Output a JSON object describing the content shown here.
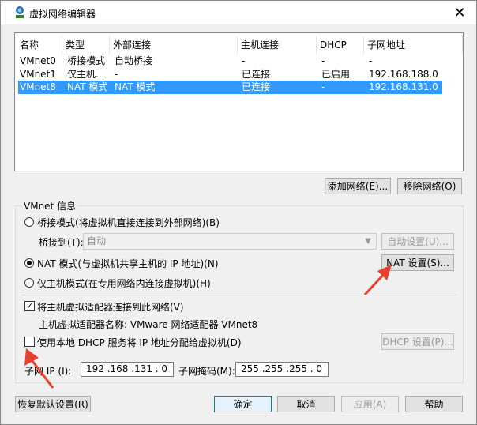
{
  "window": {
    "title": "虚拟网络编辑器",
    "icon": "vmware-network-icon",
    "close": "✕"
  },
  "table": {
    "columns": [
      "名称",
      "类型",
      "外部连接",
      "主机连接",
      "DHCP",
      "子网地址"
    ],
    "rows": [
      {
        "name": "VMnet0",
        "type": "桥接模式",
        "external": "自动桥接",
        "host": "-",
        "dhcp": "-",
        "subnet": "-"
      },
      {
        "name": "VMnet1",
        "type": "仅主机...",
        "external": "-",
        "host": "已连接",
        "dhcp": "已启用",
        "subnet": "192.168.188.0"
      },
      {
        "name": "VMnet8",
        "type": "NAT 模式",
        "external": "NAT 模式",
        "host": "已连接",
        "dhcp": "-",
        "subnet": "192.168.131.0"
      }
    ],
    "selected_row": "VMnet8"
  },
  "table_buttons": {
    "add": "添加网络(E)...",
    "remove": "移除网络(O)"
  },
  "vmnet_info": {
    "title": "VMnet 信息",
    "bridge_option": "桥接模式(将虚拟机直接连接到外部网络)(B)",
    "bridge_to_label": "桥接到(T):",
    "bridge_to_value": "自动",
    "auto_settings": "自动设置(U)...",
    "nat_option": "NAT 模式(与虚拟机共享主机的 IP 地址)(N)",
    "nat_settings": "NAT 设置(S)...",
    "host_only_option": "仅主机模式(在专用网络内连接虚拟机)(H)",
    "selected_mode": "nat",
    "connect_adapter": "将主机虚拟适配器连接到此网络(V)",
    "connect_adapter_checked": true,
    "adapter_name": "主机虚拟适配器名称: VMware 网络适配器 VMnet8",
    "use_dhcp": "使用本地 DHCP 服务将 IP 地址分配给虚拟机(D)",
    "use_dhcp_checked": false,
    "dhcp_settings": "DHCP 设置(P)...",
    "subnet_ip_label": "子网 IP (I):",
    "subnet_ip": "192 .168 .131 . 0",
    "subnet_mask_label": "子网掩码(M):",
    "subnet_mask": "255 .255 .255 . 0"
  },
  "footer": {
    "restore": "恢复默认设置(R)",
    "ok": "确定",
    "cancel": "取消",
    "apply": "应用(A)",
    "help": "帮助"
  },
  "colors": {
    "selection": "#3399ff",
    "annotation_arrow": "#e8402f"
  }
}
